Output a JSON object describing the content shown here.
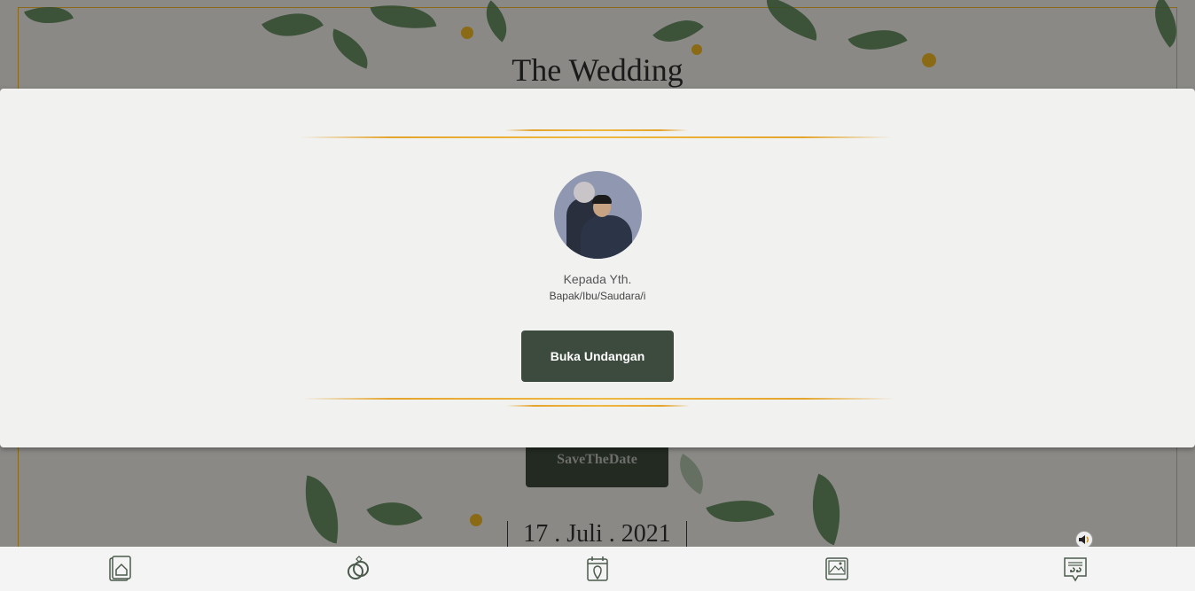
{
  "background": {
    "title": "The Wedding",
    "save_the_date": "SaveTheDate",
    "date": "17 . Juli . 2021"
  },
  "cover": {
    "greeting": "Kepada Yth.",
    "recipient": "Bapak/Ibu/Saudara/i",
    "open_button": "Buka Undangan",
    "photo": "couple-photo"
  },
  "nav": {
    "items": [
      {
        "icon": "home-icon"
      },
      {
        "icon": "rings-icon"
      },
      {
        "icon": "calendar-location-icon"
      },
      {
        "icon": "gallery-icon"
      },
      {
        "icon": "quote-icon"
      }
    ]
  },
  "colors": {
    "gold": "#e5a52d",
    "button": "#3d4a3e",
    "modal": "#f1f1f0",
    "nav_icon": "#4b5a4c"
  }
}
